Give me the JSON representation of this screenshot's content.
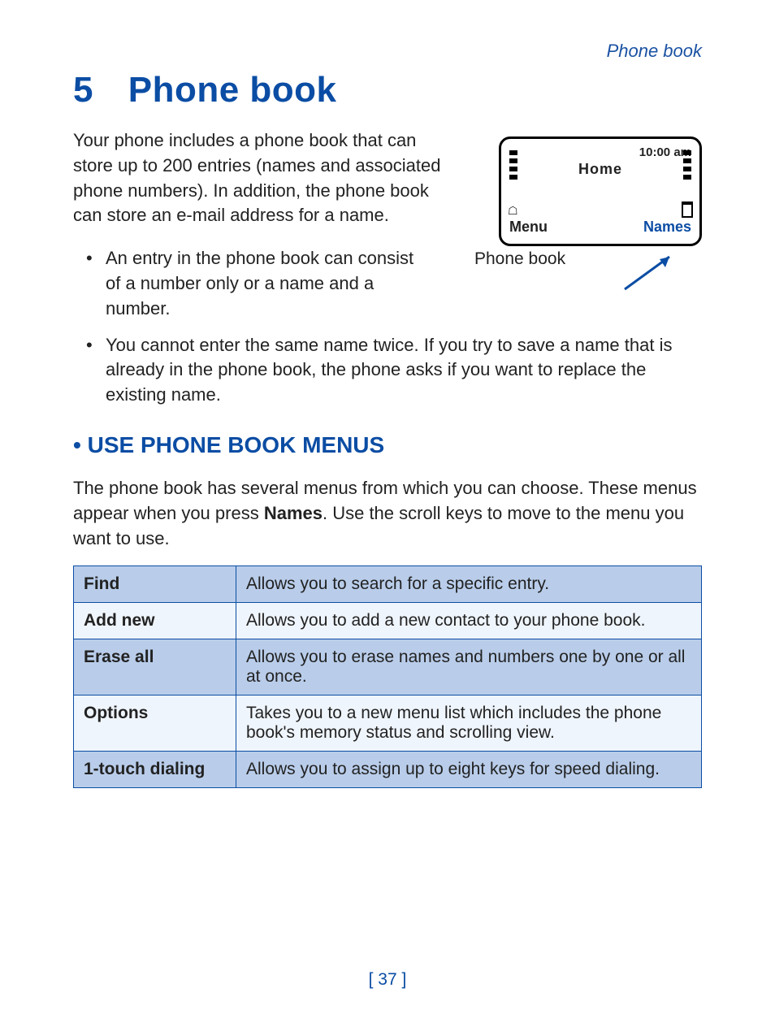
{
  "header": "Phone book",
  "chapter_number": "5",
  "chapter_title": "Phone book",
  "intro": "Your phone includes a phone book that can store up to 200 entries (names and associated phone numbers). In addition, the phone book can store an e-mail address for a name.",
  "bullets": [
    "An entry in the phone book can consist of a number only or a name and a number.",
    "You cannot enter the same name twice. If you try to save a name that is already in the phone book, the phone asks if you want to replace the existing name."
  ],
  "figure": {
    "time": "10:00 am",
    "home": "Home",
    "menu": "Menu",
    "names": "Names",
    "caption": "Phone book"
  },
  "section_title": "USE PHONE BOOK MENUS",
  "menus_intro_a": "The phone book has several menus from which you can choose. These menus appear when you press ",
  "menus_intro_bold": "Names",
  "menus_intro_b": ". Use the scroll keys to move to the menu you want to use.",
  "table_rows": [
    {
      "name": "Find",
      "desc": "Allows you to search for a specific entry."
    },
    {
      "name": "Add new",
      "desc": "Allows you to add a new contact to your phone book."
    },
    {
      "name": "Erase all",
      "desc": "Allows you to erase names and numbers one by one or all at once."
    },
    {
      "name": "Options",
      "desc": "Takes you to a new menu list which includes the phone book's memory status and scrolling view."
    },
    {
      "name": "1-touch dialing",
      "desc": "Allows you to assign up to eight keys for speed dialing."
    }
  ],
  "page_number": "[ 37 ]"
}
